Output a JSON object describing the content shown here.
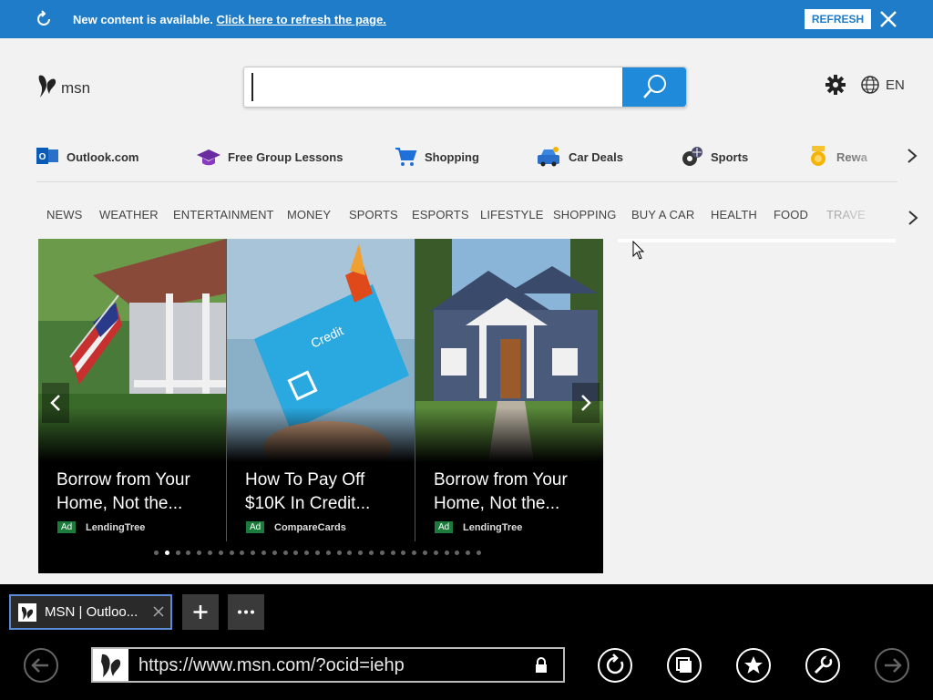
{
  "notification": {
    "message": "New content is available.",
    "link": "Click here to refresh the page.",
    "refresh_label": "REFRESH"
  },
  "header": {
    "logo_text": "msn",
    "search": {
      "value": "",
      "placeholder": ""
    },
    "language": "EN"
  },
  "quick_links": [
    {
      "label": "Outlook.com",
      "icon": "outlook-icon"
    },
    {
      "label": "Free Group Lessons",
      "icon": "graduation-cap-icon"
    },
    {
      "label": "Shopping",
      "icon": "cart-icon"
    },
    {
      "label": "Car Deals",
      "icon": "car-icon"
    },
    {
      "label": "Sports",
      "icon": "sports-balls-icon"
    },
    {
      "label": "Rewa",
      "icon": "medal-icon"
    }
  ],
  "nav": [
    "NEWS",
    "WEATHER",
    "ENTERTAINMENT",
    "MONEY",
    "SPORTS",
    "ESPORTS",
    "LIFESTYLE",
    "SHOPPING",
    "BUY A CAR",
    "HEALTH",
    "FOOD",
    "TRAVE"
  ],
  "carousel": {
    "cards": [
      {
        "title": "Borrow from Your Home, Not the...",
        "ad_label": "Ad",
        "source": "LendingTree",
        "image": "porch-with-flag"
      },
      {
        "title": "How To Pay Off $10K In Credit...",
        "ad_label": "Ad",
        "source": "CompareCards",
        "image": "burning-credit-card"
      },
      {
        "title": "Borrow from Your Home, Not the...",
        "ad_label": "Ad",
        "source": "LendingTree",
        "image": "blue-house"
      }
    ],
    "dot_count": 31,
    "active_dot": 1
  },
  "browser": {
    "tab_title": "MSN | Outloo...",
    "url": "https://www.msn.com/?ocid=iehp"
  },
  "colors": {
    "notification_bg": "#1e7cc8",
    "search_button": "#1e8ad9",
    "ad_badge": "#1a7b3a",
    "chrome_bg": "#000000"
  }
}
